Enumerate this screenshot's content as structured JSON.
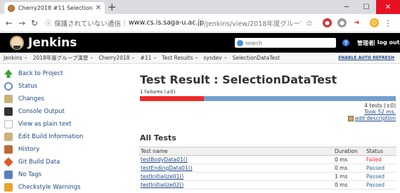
{
  "browser": {
    "tab_title": "Cherry2018 #11 SelectionDa",
    "url_security_label": "保護されていない通信",
    "url_host": "www.cs.is.saga-u.ac.jp",
    "url_path": "/jenkins/view/2018年度グループ演習/job/Cherry···"
  },
  "jenkins": {
    "title": "Jenkins",
    "search_placeholder": "search",
    "user": "管理者",
    "logout": "| log out"
  },
  "breadcrumbs": [
    "Jenkins",
    "2018年度グループ演習",
    "Cherry2018",
    "#11",
    "Test Results",
    "sysdev",
    "SelectionDataTest"
  ],
  "enable_auto_refresh": "ENABLE AUTO REFRESH",
  "sidepanel": {
    "items": [
      {
        "label": "Back to Project",
        "icon": "up-arrow-icon",
        "color": "#3aa33a"
      },
      {
        "label": "Status",
        "icon": "magnifier-icon",
        "color": "#6a8fb5"
      },
      {
        "label": "Changes",
        "icon": "notepad-icon",
        "color": "#c9b37a"
      },
      {
        "label": "Console Output",
        "icon": "terminal-icon",
        "color": "#333333"
      },
      {
        "label": "View as plain text",
        "icon": "document-icon",
        "color": "#dddddd"
      },
      {
        "label": "Edit Build Information",
        "icon": "notepad-pencil-icon",
        "color": "#c9b37a"
      },
      {
        "label": "History",
        "icon": "history-icon",
        "color": "#b86a3a"
      },
      {
        "label": "Git Build Data",
        "icon": "git-icon",
        "color": "#e05a2a"
      },
      {
        "label": "No Tags",
        "icon": "tag-icon",
        "color": "#5a7fbf"
      },
      {
        "label": "Checkstyle Warnings",
        "icon": "checkstyle-icon",
        "color": "#e8a32a"
      }
    ]
  },
  "main": {
    "title": "Test Result : SelectionDataTest",
    "failures": "1 failures (±0)",
    "fail_fraction": 0.25,
    "tests_count": "4 tests (±0)",
    "took": "Took 52 ms.",
    "add_description": "add description",
    "all_tests_heading": "All Tests",
    "columns": {
      "name": "Test name",
      "duration": "Duration",
      "status": "Status"
    },
    "rows": [
      {
        "name": "testBodyData01()",
        "duration": "0 ms",
        "status": "Failed"
      },
      {
        "name": "testEndingData01()",
        "duration": "0 ms",
        "status": "Passed"
      },
      {
        "name": "testInitialize01()",
        "duration": "1 ms",
        "status": "Passed"
      },
      {
        "name": "testInitialize02()",
        "duration": "0 ms",
        "status": "Passed"
      }
    ]
  }
}
